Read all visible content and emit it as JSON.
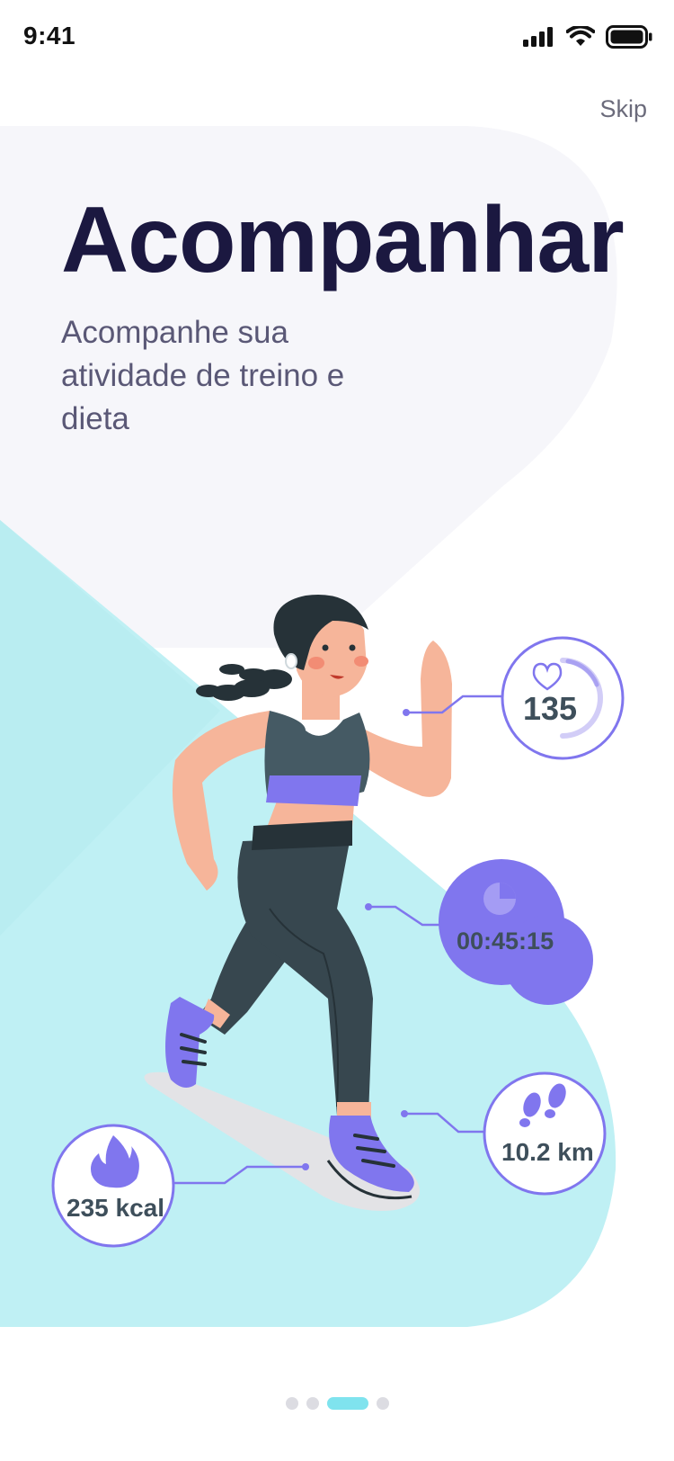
{
  "status_bar": {
    "time": "9:41"
  },
  "header": {
    "skip_label": "Skip"
  },
  "onboarding": {
    "title": "Acompanhar",
    "subtitle": "Acompanhe sua atividade de treino e dieta"
  },
  "stats": {
    "heart_rate": "135",
    "duration": "00:45:15",
    "distance": "10.2 km",
    "calories": "235 kcal"
  },
  "pagination": {
    "total": 4,
    "active_index": 2
  },
  "colors": {
    "accent_purple": "#8076ee",
    "teal_bg": "#bff0f4",
    "title_navy": "#1b1840",
    "light_bg": "#f6f6fa",
    "active_dot": "#7fe3ee"
  },
  "icons": [
    "signal-icon",
    "wifi-icon",
    "battery-icon",
    "heart-icon",
    "clock-icon",
    "footprints-icon",
    "flame-icon"
  ]
}
